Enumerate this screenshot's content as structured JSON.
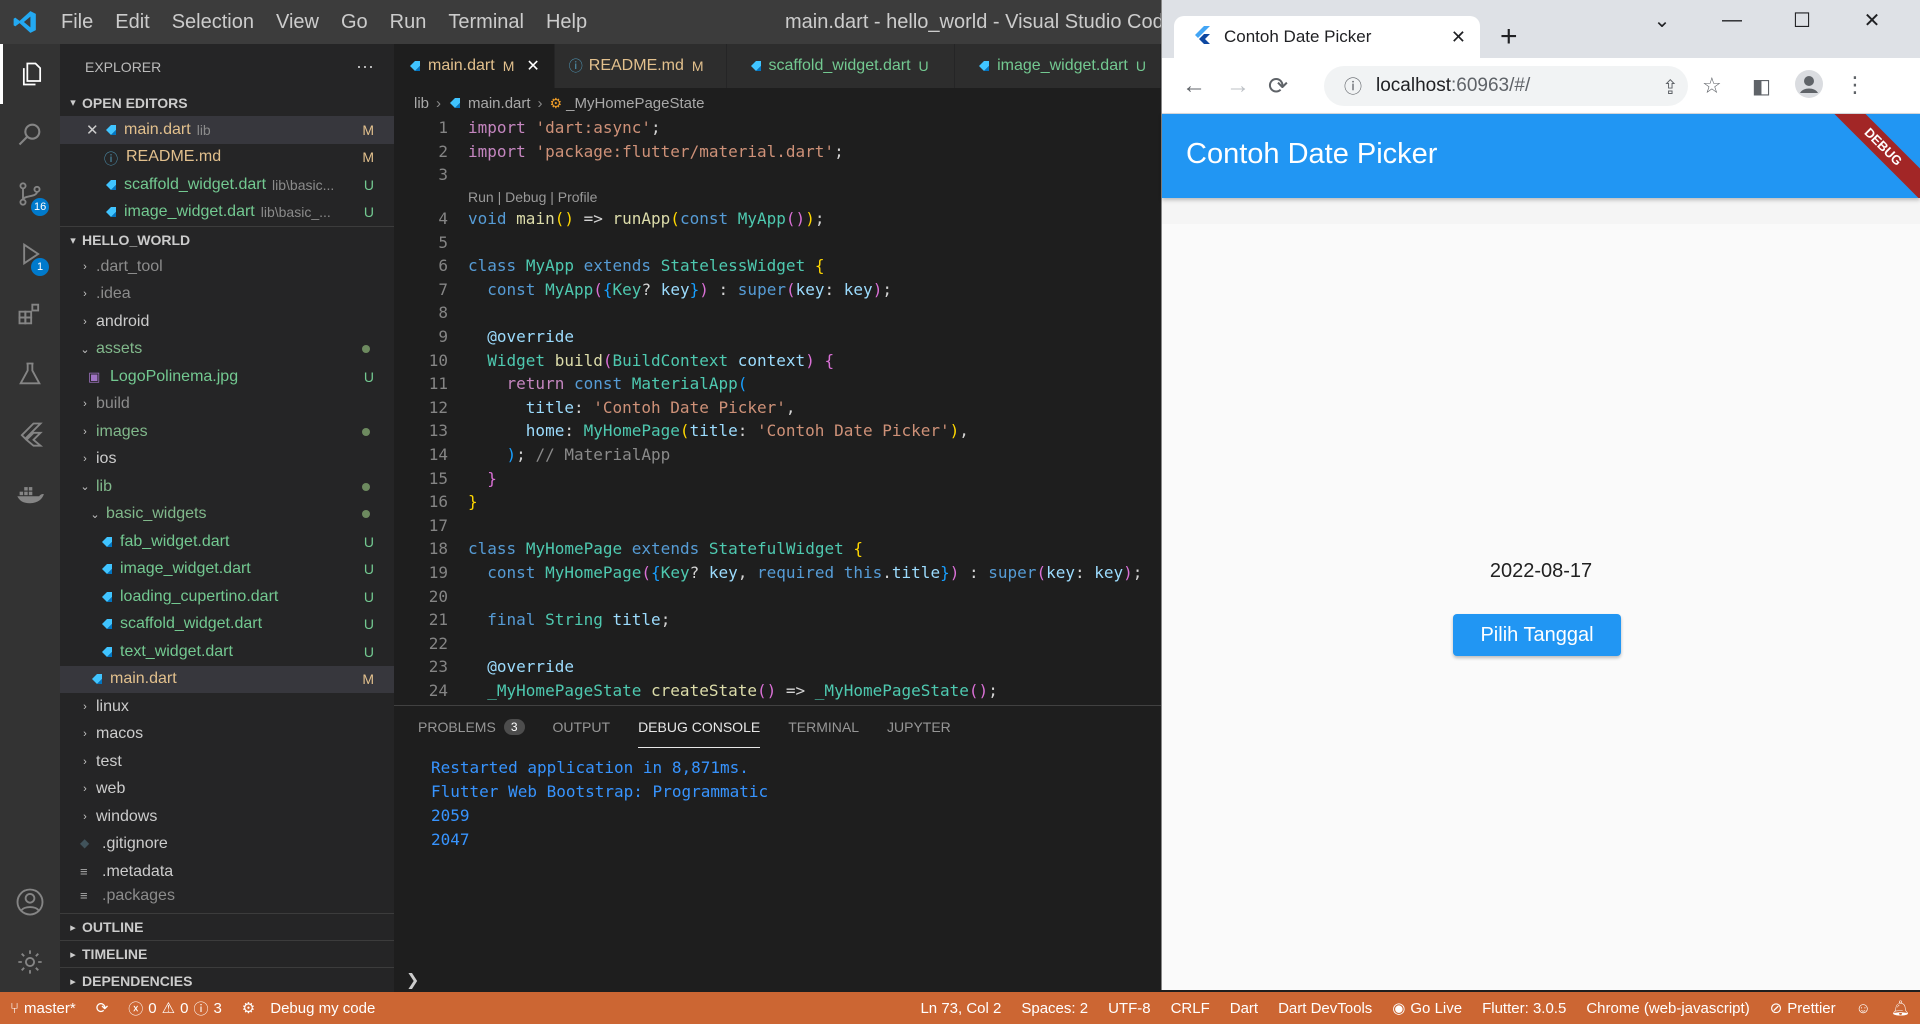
{
  "vscode": {
    "menu": [
      "File",
      "Edit",
      "Selection",
      "View",
      "Go",
      "Run",
      "Terminal",
      "Help"
    ],
    "window_title": "main.dart - hello_world - Visual Studio Code",
    "badges": {
      "source_control": "16",
      "run_debug": "1"
    },
    "sidebar": {
      "title": "EXPLORER",
      "more": "···",
      "open_editors": {
        "label": "OPEN EDITORS",
        "items": [
          {
            "name": "main.dart",
            "desc": "lib",
            "status": "M"
          },
          {
            "name": "README.md",
            "desc": "",
            "status": "M"
          },
          {
            "name": "scaffold_widget.dart",
            "desc": "lib\\basic...",
            "status": "U"
          },
          {
            "name": "image_widget.dart",
            "desc": "lib\\basic_...",
            "status": "U"
          }
        ]
      },
      "workspace": {
        "label": "HELLO_WORLD",
        "items": [
          {
            "name": ".dart_tool"
          },
          {
            "name": ".idea"
          },
          {
            "name": "android"
          },
          {
            "name": "assets"
          },
          {
            "name": "LogoPolinema.jpg",
            "status": "U"
          },
          {
            "name": "build"
          },
          {
            "name": "images"
          },
          {
            "name": "ios"
          },
          {
            "name": "lib"
          },
          {
            "name": "basic_widgets"
          },
          {
            "name": "fab_widget.dart",
            "status": "U"
          },
          {
            "name": "image_widget.dart",
            "status": "U"
          },
          {
            "name": "loading_cupertino.dart",
            "status": "U"
          },
          {
            "name": "scaffold_widget.dart",
            "status": "U"
          },
          {
            "name": "text_widget.dart",
            "status": "U"
          },
          {
            "name": "main.dart",
            "status": "M"
          },
          {
            "name": "linux"
          },
          {
            "name": "macos"
          },
          {
            "name": "test"
          },
          {
            "name": "web"
          },
          {
            "name": "windows"
          },
          {
            "name": ".gitignore"
          },
          {
            "name": ".metadata"
          },
          {
            "name": ".packages"
          }
        ]
      },
      "sections": [
        "OUTLINE",
        "TIMELINE",
        "DEPENDENCIES"
      ]
    },
    "tabs": [
      {
        "name": "main.dart",
        "status": "M"
      },
      {
        "name": "README.md",
        "status": "M"
      },
      {
        "name": "scaffold_widget.dart",
        "status": "U"
      },
      {
        "name": "image_widget.dart",
        "status": "U"
      }
    ],
    "breadcrumb": [
      "lib",
      "main.dart",
      "_MyHomePageState"
    ],
    "codelens": "Run | Debug | Profile",
    "line_numbers": [
      "1",
      "2",
      "3",
      "4",
      "5",
      "6",
      "7",
      "8",
      "9",
      "10",
      "11",
      "12",
      "13",
      "14",
      "15",
      "16",
      "17",
      "18",
      "19",
      "20",
      "21",
      "22",
      "23",
      "24"
    ],
    "panel": {
      "tabs": [
        "PROBLEMS",
        "OUTPUT",
        "DEBUG CONSOLE",
        "TERMINAL",
        "JUPYTER"
      ],
      "problems_count": "3",
      "output": [
        "Restarted application in 8,871ms.",
        "Flutter Web Bootstrap: Programmatic",
        "2059",
        "2047"
      ],
      "prompt": "❯"
    },
    "status": {
      "branch": "master*",
      "errors": "0",
      "warnings": "0",
      "infos": "3",
      "debug": "Debug my code",
      "position": "Ln 73, Col 2",
      "spaces": "Spaces: 2",
      "encoding": "UTF-8",
      "eol": "CRLF",
      "language": "Dart",
      "devtools": "Dart DevTools",
      "golive": "Go Live",
      "flutter": "Flutter: 3.0.5",
      "device": "Chrome (web-javascript)",
      "prettier": "Prettier"
    },
    "colors": {
      "statusbar": "#cc6633",
      "modified": "#e2c08d",
      "untracked": "#73c991",
      "accent": "#007acc"
    }
  },
  "chrome": {
    "tab_title": "Contoh Date Picker",
    "url_host": "localhost",
    "url_path": ":60963/#/",
    "app_title": "Contoh Date Picker",
    "debug_banner": "DEBUG",
    "date": "2022-08-17",
    "button": "Pilih Tanggal",
    "colors": {
      "appbar": "#2196f3",
      "debug_banner": "#a22626"
    }
  }
}
